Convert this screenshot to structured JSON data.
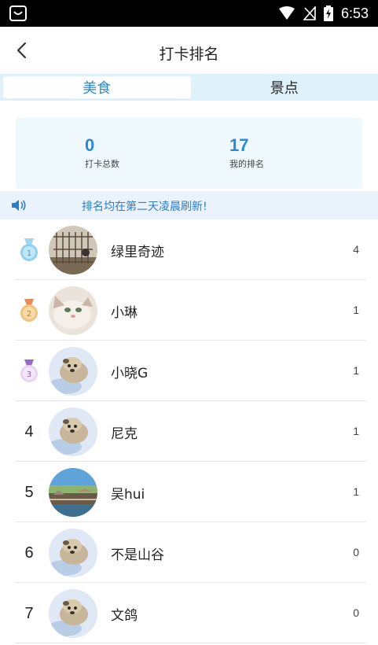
{
  "status_bar": {
    "time": "6:53"
  },
  "header": {
    "title": "打卡排名"
  },
  "tabs": [
    {
      "label": "美食",
      "active": true
    },
    {
      "label": "景点",
      "active": false
    }
  ],
  "stats": {
    "total_checkins": {
      "value": "0",
      "label": "打卡总数"
    },
    "my_rank": {
      "value": "17",
      "label": "我的排名"
    }
  },
  "notice": {
    "text": "排名均在第二天凌晨刷新!"
  },
  "ranking": [
    {
      "rank": "1",
      "medal": "gold-blue",
      "name": "绿里奇迹",
      "count": "4",
      "avatar": "birdcage"
    },
    {
      "rank": "2",
      "medal": "orange",
      "name": "小琳",
      "count": "1",
      "avatar": "cat"
    },
    {
      "rank": "3",
      "medal": "purple",
      "name": "小晓G",
      "count": "1",
      "avatar": "dog"
    },
    {
      "rank": "4",
      "medal": "",
      "name": "尼克",
      "count": "1",
      "avatar": "dog"
    },
    {
      "rank": "5",
      "medal": "",
      "name": "吴hui",
      "count": "1",
      "avatar": "landscape"
    },
    {
      "rank": "6",
      "medal": "",
      "name": "不是山谷",
      "count": "0",
      "avatar": "dog"
    },
    {
      "rank": "7",
      "medal": "",
      "name": "文鸽",
      "count": "0",
      "avatar": "dog"
    }
  ]
}
